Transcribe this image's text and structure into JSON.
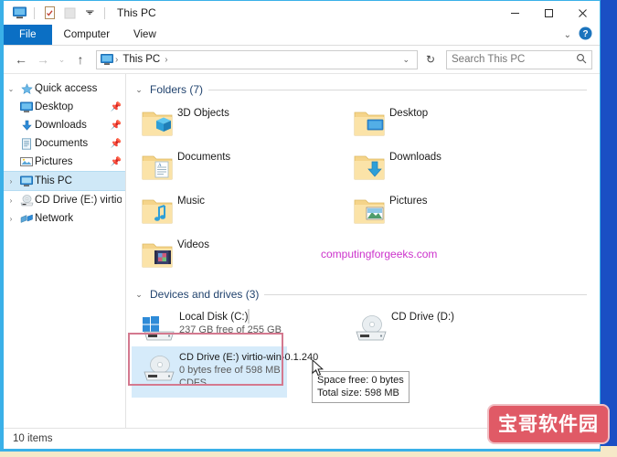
{
  "window": {
    "title": "This PC",
    "quick_access_toolbar": [
      {
        "name": "this-pc-icon",
        "glyph": "monitor"
      },
      {
        "name": "properties-icon",
        "glyph": "doc-check"
      },
      {
        "name": "new-folder-icon",
        "glyph": "folder-blank"
      },
      {
        "name": "customize-toolbar-chevron",
        "glyph": "▾"
      }
    ],
    "controls": {
      "minimize": "─",
      "maximize": "□",
      "close": "✕"
    }
  },
  "ribbon": {
    "tabs": [
      {
        "label": "File",
        "active": true
      },
      {
        "label": "Computer",
        "active": false
      },
      {
        "label": "View",
        "active": false
      }
    ],
    "collapse_chevron": "⌄",
    "help_label": "?"
  },
  "addressbar": {
    "back": "←",
    "forward": "→",
    "recent": "⌄",
    "up": "↑",
    "breadcrumb": {
      "icon": "monitor-icon",
      "items": [
        "This PC"
      ],
      "separator": "›",
      "dropdown_chevron": "⌄"
    },
    "refresh": "↻",
    "search": {
      "placeholder": "Search This PC",
      "icon": "search-icon"
    }
  },
  "sidebar": {
    "items": [
      {
        "label": "Quick access",
        "icon": "star-icon",
        "expander": "⌄",
        "indent": false,
        "pinned": false,
        "selected": false
      },
      {
        "label": "Desktop",
        "icon": "desktop-icon",
        "expander": "",
        "indent": true,
        "pinned": true,
        "selected": false
      },
      {
        "label": "Downloads",
        "icon": "downloads-icon",
        "expander": "",
        "indent": true,
        "pinned": true,
        "selected": false
      },
      {
        "label": "Documents",
        "icon": "documents-icon",
        "expander": "",
        "indent": true,
        "pinned": true,
        "selected": false
      },
      {
        "label": "Pictures",
        "icon": "pictures-icon",
        "expander": "",
        "indent": true,
        "pinned": true,
        "selected": false
      },
      {
        "label": "This PC",
        "icon": "this-pc-icon",
        "expander": "›",
        "indent": false,
        "pinned": false,
        "selected": true
      },
      {
        "label": "CD Drive (E:) virtio-w",
        "icon": "cd-drive-icon",
        "expander": "›",
        "indent": false,
        "pinned": false,
        "selected": false
      },
      {
        "label": "Network",
        "icon": "network-icon",
        "expander": "›",
        "indent": false,
        "pinned": false,
        "selected": false
      }
    ]
  },
  "main": {
    "folders_group": {
      "chevron": "⌄",
      "title": "Folders (7)",
      "items": [
        {
          "label": "3D Objects",
          "icon": "folder-3d-objects-icon"
        },
        {
          "label": "Desktop",
          "icon": "folder-desktop-icon"
        },
        {
          "label": "Documents",
          "icon": "folder-documents-icon"
        },
        {
          "label": "Downloads",
          "icon": "folder-downloads-icon"
        },
        {
          "label": "Music",
          "icon": "folder-music-icon"
        },
        {
          "label": "Pictures",
          "icon": "folder-pictures-icon"
        },
        {
          "label": "Videos",
          "icon": "folder-videos-icon"
        }
      ]
    },
    "devices_group": {
      "chevron": "⌄",
      "title": "Devices and drives (3)",
      "items": [
        {
          "name": "Local Disk (C:)",
          "icon": "local-disk-icon",
          "capacity_text": "237 GB free of 255 GB",
          "used_percent": 7,
          "filesystem": "",
          "selected": false,
          "has_bar": true
        },
        {
          "name": "CD Drive (D:)",
          "icon": "cd-drive-icon",
          "capacity_text": "",
          "used_percent": 0,
          "filesystem": "",
          "selected": false,
          "has_bar": false
        },
        {
          "name": "CD Drive (E:) virtio-win-0.1.240",
          "icon": "cd-drive-icon",
          "capacity_text": "0 bytes free of 598 MB",
          "used_percent": 100,
          "filesystem": "CDFS",
          "selected": true,
          "has_bar": false
        }
      ]
    },
    "watermark": "computingforgeeks.com"
  },
  "tooltip": {
    "line1": "Space free: 0 bytes",
    "line2": "Total size: 598 MB"
  },
  "statusbar": {
    "item_count": "10 items"
  },
  "brand_badge": {
    "text": "宝哥软件园"
  },
  "colors": {
    "accent_blue": "#0b6fc4",
    "backdrop_blue": "#1a4fc4",
    "selection_blue": "#d6ebfa",
    "nav_selection_blue": "#cfe8f7",
    "annotation_pink": "#d4798f",
    "watermark_magenta": "#cc33cc",
    "badge_red": "#e05a66",
    "capacity_blue": "#1e90d6",
    "window_border_cyan": "#3ab0e8"
  }
}
